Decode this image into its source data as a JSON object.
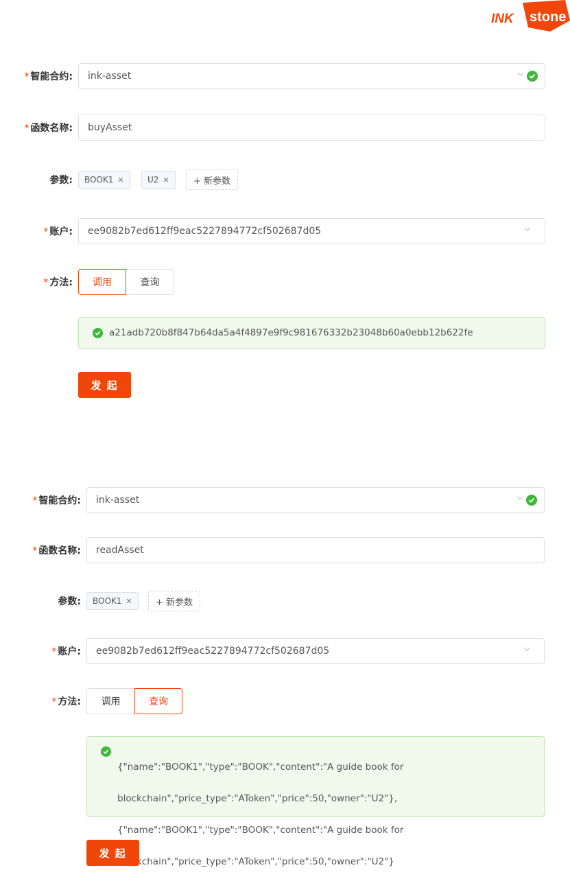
{
  "logo": {
    "text": "stone",
    "mark": "INK"
  },
  "form1": {
    "contract_label": "智能合约:",
    "contract_value": "ink-asset",
    "function_label": "函数名称:",
    "function_value": "buyAsset",
    "params_label": "参数:",
    "params": [
      "BOOK1",
      "U2"
    ],
    "new_param_label": "+ 新参数",
    "account_label": "账户:",
    "account_value": "ee9082b7ed612ff9eac5227894772cf502687d05",
    "method_label": "方法:",
    "methods": [
      "调用",
      "查询"
    ],
    "active_method": "调用",
    "result_text": "a21adb720b8f847b64da5a4f4897e9f9c981676332b23048b60a0ebb12b622fe",
    "submit_label": "发 起"
  },
  "form2": {
    "contract_label": "智能合约:",
    "contract_value": "ink-asset",
    "function_label": "函数名称:",
    "function_value": "readAsset",
    "params_label": "参数:",
    "params": [
      "BOOK1"
    ],
    "new_param_label": "+ 新参数",
    "account_label": "账户:",
    "account_value": "ee9082b7ed612ff9eac5227894772cf502687d05",
    "method_label": "方法:",
    "methods": [
      "调用",
      "查询"
    ],
    "active_method": "查询",
    "result_lines": [
      "{\"name\":\"BOOK1\",\"type\":\"BOOK\",\"content\":\"A guide book for",
      "blockchain\",\"price_type\":\"AToken\",\"price\":50,\"owner\":\"U2\"},",
      "{\"name\":\"BOOK1\",\"type\":\"BOOK\",\"content\":\"A guide book for",
      "blockchain\",\"price_type\":\"AToken\",\"price\":50,\"owner\":\"U2\"}"
    ],
    "submit_label": "发 起"
  },
  "colors": {
    "accent": "#f0460a",
    "success": "#3fb73a",
    "success_bg": "#f0f9eb",
    "success_border": "#c2e7b0"
  },
  "icons": [
    "ink-logo",
    "chevron-down-icon",
    "check-circle-icon",
    "close-icon"
  ]
}
